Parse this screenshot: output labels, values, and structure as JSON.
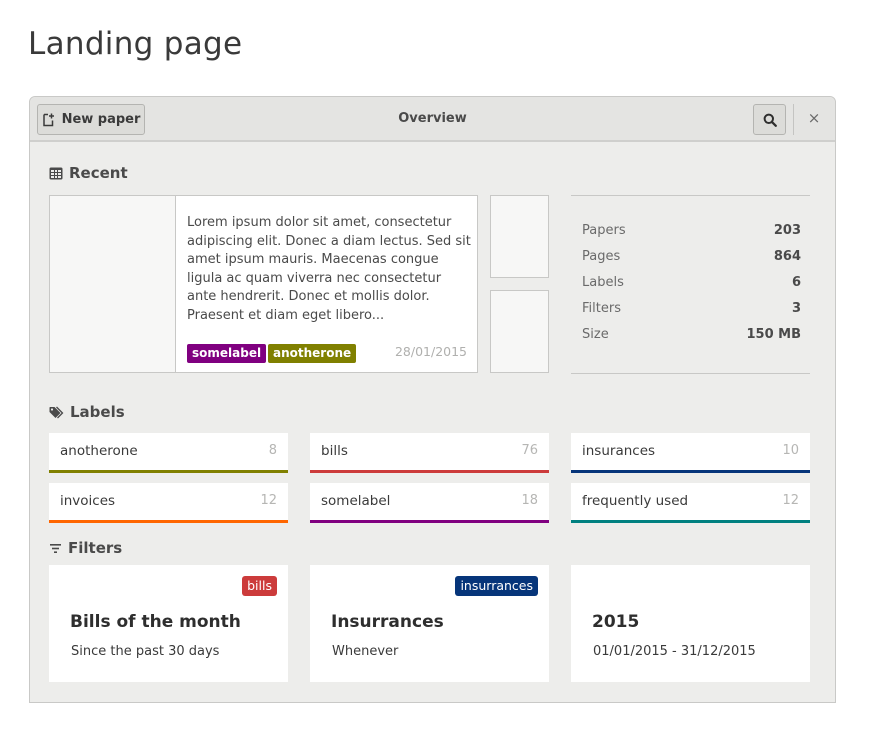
{
  "page": {
    "title": "Landing page"
  },
  "header": {
    "new_paper_label": "New paper",
    "title": "Overview",
    "search_icon": "search-icon",
    "close_glyph": "×"
  },
  "sections": {
    "recent": "Recent",
    "labels": "Labels",
    "filters": "Filters"
  },
  "recent": {
    "excerpt": "Lorem ipsum dolor sit amet, consectetur adipiscing elit. Donec a diam lectus. Sed sit amet ipsum mauris. Maecenas congue ligula ac quam viverra nec consectetur ante hendrerit. Donec et mollis dolor. Praesent et diam eget libero...",
    "date": "28/01/2015",
    "tags": [
      {
        "label": "somelabel",
        "color": "#800080"
      },
      {
        "label": "anotherone",
        "color": "#808000"
      }
    ]
  },
  "stats": [
    {
      "label": "Papers",
      "value": "203"
    },
    {
      "label": "Pages",
      "value": "864"
    },
    {
      "label": "Labels",
      "value": "6"
    },
    {
      "label": "Filters",
      "value": "3"
    },
    {
      "label": "Size",
      "value": "150 MB"
    }
  ],
  "labels": [
    {
      "name": "anotherone",
      "count": "8",
      "color": "#808000"
    },
    {
      "name": "bills",
      "count": "76",
      "color": "#cc3b3b"
    },
    {
      "name": "insurances",
      "count": "10",
      "color": "#06357a"
    },
    {
      "name": "invoices",
      "count": "12",
      "color": "#ff6600"
    },
    {
      "name": "somelabel",
      "count": "18",
      "color": "#800080"
    },
    {
      "name": "frequently used",
      "count": "12",
      "color": "#008080"
    }
  ],
  "filters": [
    {
      "tag": "bills",
      "tag_color": "#cc3b3b",
      "title": "Bills of the month",
      "subtitle": "Since the past 30 days"
    },
    {
      "tag": "insurrances",
      "tag_color": "#06357a",
      "title": "Insurrances",
      "subtitle": "Whenever"
    },
    {
      "tag": "",
      "tag_color": "",
      "title": "2015",
      "subtitle": "01/01/2015 - 31/12/2015"
    }
  ]
}
